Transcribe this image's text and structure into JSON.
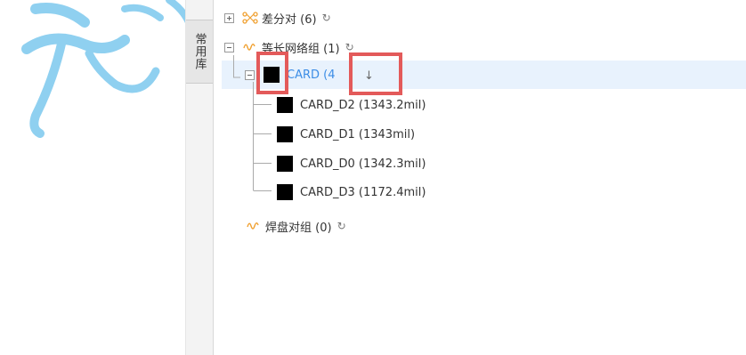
{
  "sidebar": {
    "tab_label": "常用库"
  },
  "tree": {
    "diff_pairs": {
      "label": "差分对 (6)",
      "icon": "diff-pair-icon",
      "expander": "plus"
    },
    "length_groups": {
      "label": "等长网络组 (1)",
      "icon": "wave-icon",
      "expander": "minus"
    },
    "card_group": {
      "label": "CARD (4",
      "sort_arrow": "↓",
      "color": "#000000",
      "children": [
        {
          "label": "CARD_D2 (1343.2mil)",
          "color": "#000000"
        },
        {
          "label": "CARD_D1 (1343mil)",
          "color": "#000000"
        },
        {
          "label": "CARD_D0 (1342.3mil)",
          "color": "#000000"
        },
        {
          "label": "CARD_D3 (1172.4mil)",
          "color": "#000000"
        }
      ]
    },
    "pad_pairs": {
      "label": "焊盘对组 (0)",
      "icon": "wave-icon"
    },
    "refresh_glyph": "↻"
  },
  "colors": {
    "selection": "#e8f2fd",
    "selected_text": "#3c8de6",
    "highlight_box": "#e35a5a",
    "accent_icon": "#f0a030"
  }
}
